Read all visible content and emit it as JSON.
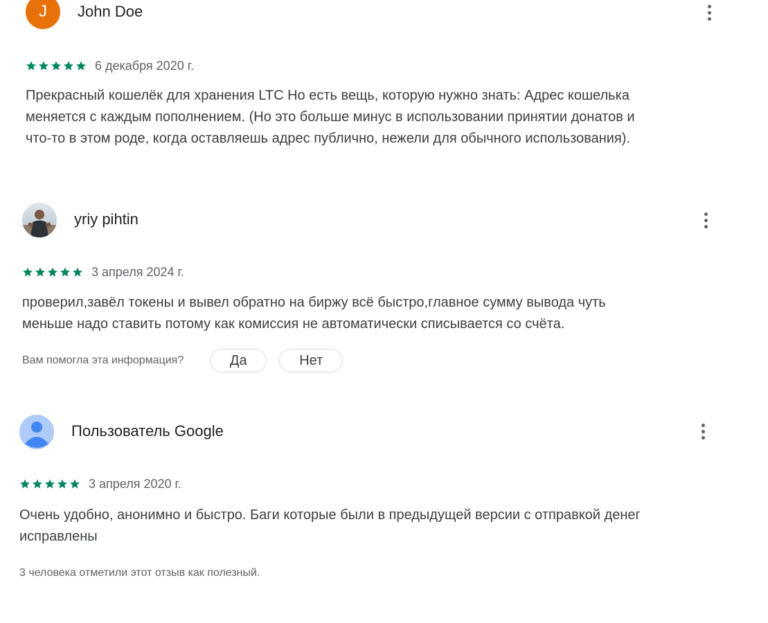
{
  "reviews": [
    {
      "author": "John Doe",
      "avatar_letter": "J",
      "avatar_color": "#e8710a",
      "avatar_icon": "letter-avatar",
      "rating": 5,
      "date": "6 декабря 2020 г.",
      "text_lines": [
        "Прекрасный кошелёк для хранения LTC Но есть вещь, которую нужно знать: Адрес кошелька",
        "меняется с каждым пополнением. (Но это больше минус в использовании принятии донатов и",
        "что-то в этом роде, когда оставляешь адрес публично, нежели для обычного использования)."
      ],
      "menu_icon": "more-vert-icon"
    },
    {
      "author": "yriy pihtin",
      "avatar_icon": "photo-avatar",
      "rating": 5,
      "date": "3 апреля 2024 г.",
      "text_lines": [
        "проверил,завёл токены и вывел обратно на биржу всё быстро,главное сумму вывода чуть",
        "меньше надо ставить потому как комиссия не автоматически списывается со счёта."
      ],
      "helpful": {
        "question": "Вам помогла эта информация?",
        "yes_label": "Да",
        "no_label": "Нет"
      },
      "menu_icon": "more-vert-icon"
    },
    {
      "author": "Пользователь Google",
      "avatar_icon": "default-user-avatar",
      "rating": 5,
      "date": "3 апреля 2020 г.",
      "text_lines": [
        "Очень удобно, анонимно и быстро. Баги которые были в предыдущей версии с отправкой денег",
        "исправлены"
      ],
      "useful_count_text": "3 человека отметили этот отзыв как полезный.",
      "menu_icon": "more-vert-icon"
    }
  ],
  "colors": {
    "star": "#01875f",
    "text_primary": "#202124",
    "text_secondary": "#5f6368",
    "button_border": "#dadce0"
  }
}
